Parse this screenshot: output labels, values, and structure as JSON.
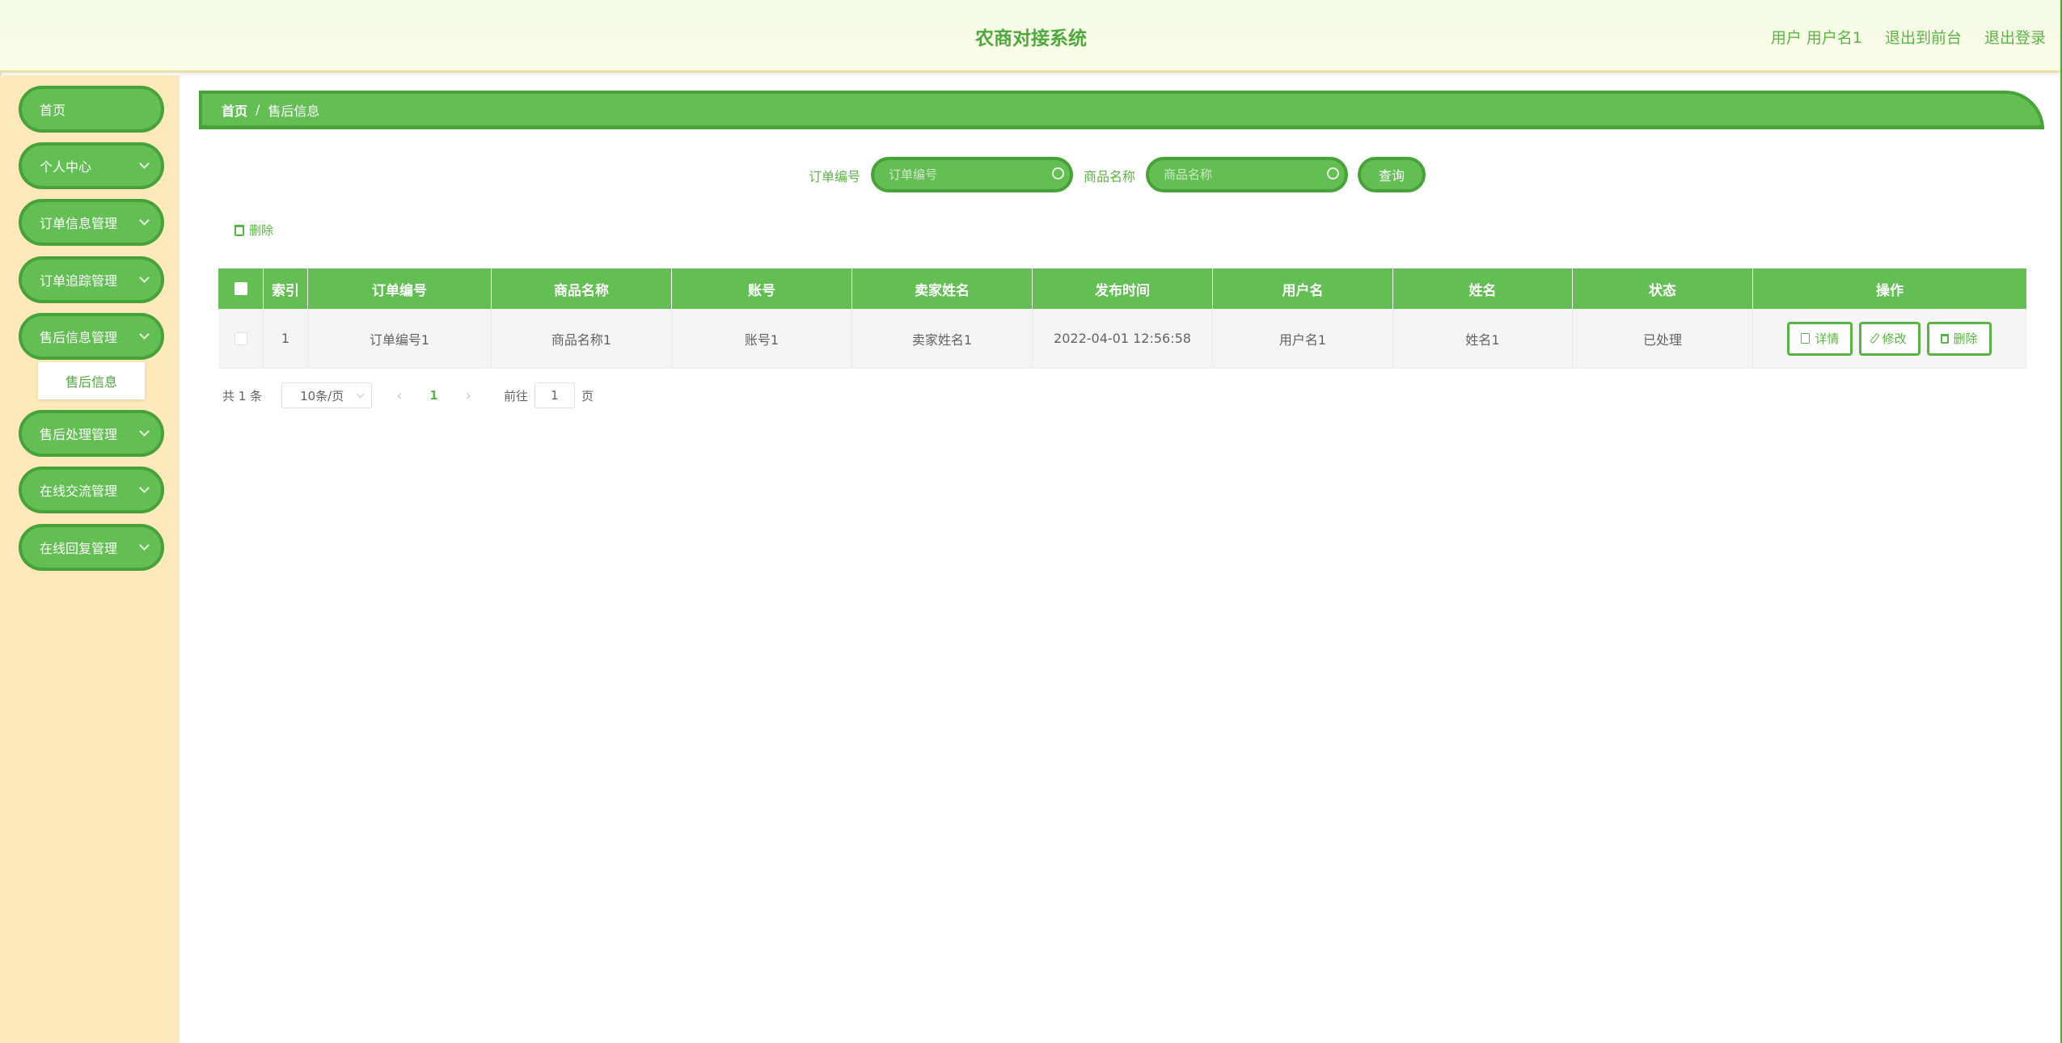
{
  "header": {
    "title": "农商对接系统",
    "user_prefix": "用户",
    "username": "用户名1",
    "to_front": "退出到前台",
    "logout": "退出登录"
  },
  "sidebar": {
    "items": [
      {
        "label": "首页"
      },
      {
        "label": "个人中心"
      },
      {
        "label": "订单信息管理"
      },
      {
        "label": "订单追踪管理"
      },
      {
        "label": "售后信息管理"
      },
      {
        "label": "售后处理管理"
      },
      {
        "label": "在线交流管理"
      },
      {
        "label": "在线回复管理"
      }
    ],
    "submenu_label": "售后信息"
  },
  "breadcrumb": {
    "home": "首页",
    "separator": "/",
    "current": "售后信息"
  },
  "search": {
    "order_label": "订单编号",
    "order_placeholder": "订单编号",
    "goods_label": "商品名称",
    "goods_placeholder": "商品名称",
    "query_button": "查询"
  },
  "actions": {
    "delete_label": "删除"
  },
  "table": {
    "headers": {
      "index": "索引",
      "order_no": "订单编号",
      "goods_name": "商品名称",
      "account": "账号",
      "seller_name": "卖家姓名",
      "publish_time": "发布时间",
      "username": "用户名",
      "name": "姓名",
      "status": "状态",
      "operation": "操作"
    },
    "rows": [
      {
        "index": "1",
        "order_no": "订单编号1",
        "goods_name": "商品名称1",
        "account": "账号1",
        "seller_name": "卖家姓名1",
        "publish_time": "2022-04-01 12:56:58",
        "username": "用户名1",
        "name": "姓名1",
        "status": "已处理",
        "btn_detail": "详情",
        "btn_edit": "修改",
        "btn_delete": "删除"
      }
    ]
  },
  "pagination": {
    "total": "共 1 条",
    "page_size": "10条/页",
    "prev": "‹",
    "current_page": "1",
    "next": "›",
    "goto_label": "前往",
    "goto_value": "1",
    "page_suffix": "页"
  },
  "colors": {
    "accent": "#63be53",
    "accent_border": "#48a23a",
    "sidebar_bg": "#fde9bb"
  }
}
